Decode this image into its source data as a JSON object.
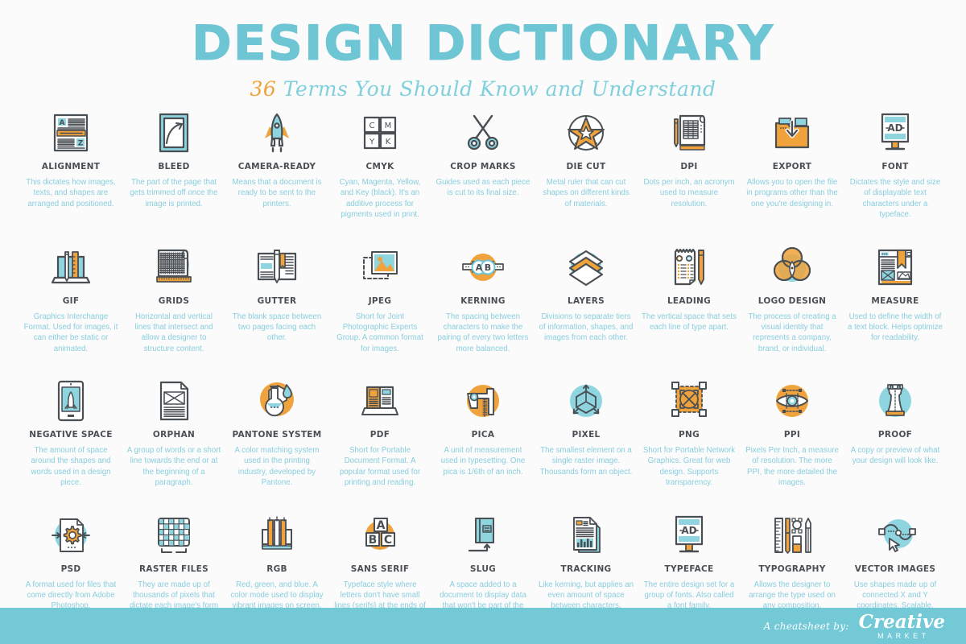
{
  "header": {
    "title": "DESIGN DICTIONARY",
    "subtitle_number": "36",
    "subtitle_rest": "Terms You Should Know and Understand"
  },
  "colors": {
    "background": "#fbfbfb",
    "teal": "#6ec6d4",
    "teal_light": "#8ed5e0",
    "orange": "#f0a23c",
    "dark": "#4a4f54",
    "body_text": "#89cede",
    "footer_bar": "#73c9d6"
  },
  "terms": [
    {
      "icon": "document-alignment-icon",
      "name": "ALIGNMENT",
      "desc": "This dictates how images, texts, and shapes are arranged and positioned."
    },
    {
      "icon": "bleed-frame-arrow-icon",
      "name": "BLEED",
      "desc": "The part of the page that gets trimmed off once the image is printed."
    },
    {
      "icon": "rocket-launch-icon",
      "name": "CAMERA-READY",
      "desc": "Means that a document is ready to be sent to the printers."
    },
    {
      "icon": "cmyk-swatches-icon",
      "name": "CMYK",
      "desc": "Cyan, Magenta, Yellow, and Key (black). It's an additive process for pigments used in print."
    },
    {
      "icon": "scissors-icon",
      "name": "CROP MARKS",
      "desc": "Guides used as each piece is cut to its final size."
    },
    {
      "icon": "star-die-cut-icon",
      "name": "DIE CUT",
      "desc": "Metal ruler that can cut shapes on different kinds of materials."
    },
    {
      "icon": "blueprint-pencil-icon",
      "name": "DPI",
      "desc": "Dots per inch, an acronym used to measure resolution."
    },
    {
      "icon": "folder-download-icon",
      "name": "EXPORT",
      "desc": "Allows you to open the file in programs other than the one you're designing in."
    },
    {
      "icon": "billboard-ad-icon",
      "name": "FONT",
      "desc": "Dictates the style and size of displayable text characters under a typeface."
    },
    {
      "icon": "laptop-pencil-ruler-icon",
      "name": "GIF",
      "desc": "Graphics Interchange Format. Used for images, it can either be static or animated."
    },
    {
      "icon": "grid-blueprint-ruler-icon",
      "name": "GRIDS",
      "desc": "Horizontal and vertical lines that intersect and allow a designer to structure content."
    },
    {
      "icon": "open-book-pencil-icon",
      "name": "GUTTER",
      "desc": "The blank space between two pages facing each other."
    },
    {
      "icon": "photo-frame-icon",
      "name": "JPEG",
      "desc": "Short for Joint Photographic Experts Group. A common format for images."
    },
    {
      "icon": "kerning-ab-icon",
      "name": "KERNING",
      "desc": "The spacing between characters to make the pairing of every two letters more balanced."
    },
    {
      "icon": "layers-stack-icon",
      "name": "LAYERS",
      "desc": "Divisions to separate tiers of information, shapes, and images from each other."
    },
    {
      "icon": "notepad-pencil-icon",
      "name": "LEADING",
      "desc": "The vertical space that sets each line of type apart."
    },
    {
      "icon": "venn-circles-icon",
      "name": "LOGO DESIGN",
      "desc": "The process of creating a visual identity that represents a company, brand, or individual."
    },
    {
      "icon": "webpage-bookmark-icon",
      "name": "MEASURE",
      "desc": "Used to define the width of a text block. Helps optimize for readability."
    },
    {
      "icon": "tablet-rocket-icon",
      "name": "NEGATIVE SPACE",
      "desc": "The amount of space around the shapes and words used in a design piece."
    },
    {
      "icon": "document-envelope-icon",
      "name": "ORPHAN",
      "desc": "A group of words or a short line towards the end or at the beginning of a paragraph."
    },
    {
      "icon": "flask-swatch-icon",
      "name": "PANTONE SYSTEM",
      "desc": "A color matching system used in the printing industry, developed by Pantone."
    },
    {
      "icon": "laptop-book-icon",
      "name": "PDF",
      "desc": "Short for Portable Document Format. A popular format used for printing and reading."
    },
    {
      "icon": "caliper-icon",
      "name": "PICA",
      "desc": "A unit of measurement used in typesetting. One pica is 1/6th of an inch."
    },
    {
      "icon": "cube-arrows-icon",
      "name": "PIXEL",
      "desc": "The smallest element on a single raster image. Thousands form an object."
    },
    {
      "icon": "transparency-selection-icon",
      "name": "PNG",
      "desc": "Short for Portable Network Graphics. Great for web design. Supports transparency."
    },
    {
      "icon": "eye-resolution-icon",
      "name": "PPI",
      "desc": "Pixels Per Inch, a measure of resolution. The more PPI, the more detailed the images."
    },
    {
      "icon": "chess-rook-icon",
      "name": "PROOF",
      "desc": "A copy or preview of what your design will look like."
    },
    {
      "icon": "document-gear-icon",
      "name": "PSD",
      "desc": "A format used for files that come directly from Adobe Photoshop."
    },
    {
      "icon": "pixel-grid-icon",
      "name": "RASTER FILES",
      "desc": "They are made up of thousands of pixels that dictate each image's form and color."
    },
    {
      "icon": "test-tubes-icon",
      "name": "RGB",
      "desc": "Red, green, and blue. A color mode used to display vibrant images on screen."
    },
    {
      "icon": "abc-blocks-icon",
      "name": "SANS SERIF",
      "desc": "Typeface style where letters don't have small lines (serifs) at the ends of each character."
    },
    {
      "icon": "book-arrow-icon",
      "name": "SLUG",
      "desc": "A space added to a document to display data that won't be part of the final product."
    },
    {
      "icon": "documents-chart-icon",
      "name": "TRACKING",
      "desc": "Like kerning, but applies an even amount of space between characters."
    },
    {
      "icon": "billboard-ad-icon",
      "name": "TYPEFACE",
      "desc": "The entire design set for a group of fonts. Also called a font family."
    },
    {
      "icon": "design-tools-icon",
      "name": "TYPOGRAPHY",
      "desc": "Allows the designer to arrange the type used on any composition."
    },
    {
      "icon": "vector-bezier-icon",
      "name": "VECTOR IMAGES",
      "desc": "Use shapes made up of connected X and Y coordinates. Scalable."
    }
  ],
  "footer": {
    "credit": "A cheatsheet by:",
    "brand_name": "Creative",
    "brand_sub": "MARKET"
  }
}
